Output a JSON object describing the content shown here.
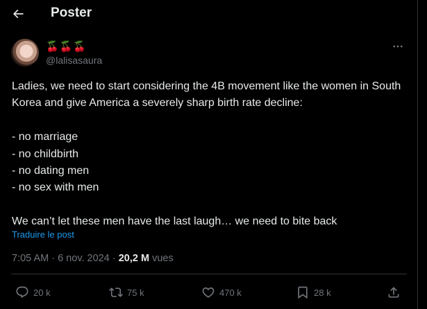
{
  "header": {
    "title": "Poster"
  },
  "author": {
    "name": "🍒🍒🍒",
    "handle": "@lalisasaura"
  },
  "tweet": {
    "text": "Ladies, we need to start considering the 4B movement like the women in South Korea and give America a severely sharp birth rate decline:\n\n- no marriage\n- no childbirth\n- no dating men\n- no sex with men\n\nWe can’t let these men have the last laugh… we need to bite back",
    "translate_label": "Traduire le post"
  },
  "meta": {
    "time": "7:05 AM",
    "date": "6 nov. 2024",
    "views_count": "20,2 M",
    "views_label": "vues"
  },
  "actions": {
    "replies": "20 k",
    "reposts": "75 k",
    "likes": "470 k",
    "bookmarks": "28 k"
  },
  "colors": {
    "background": "#000000",
    "text": "#e7e9ea",
    "muted": "#71767b",
    "link": "#1d9bf0",
    "border": "#2f3336"
  },
  "icons": [
    "back-arrow-icon",
    "more-icon",
    "reply-icon",
    "repost-icon",
    "like-icon",
    "bookmark-icon",
    "share-icon"
  ]
}
